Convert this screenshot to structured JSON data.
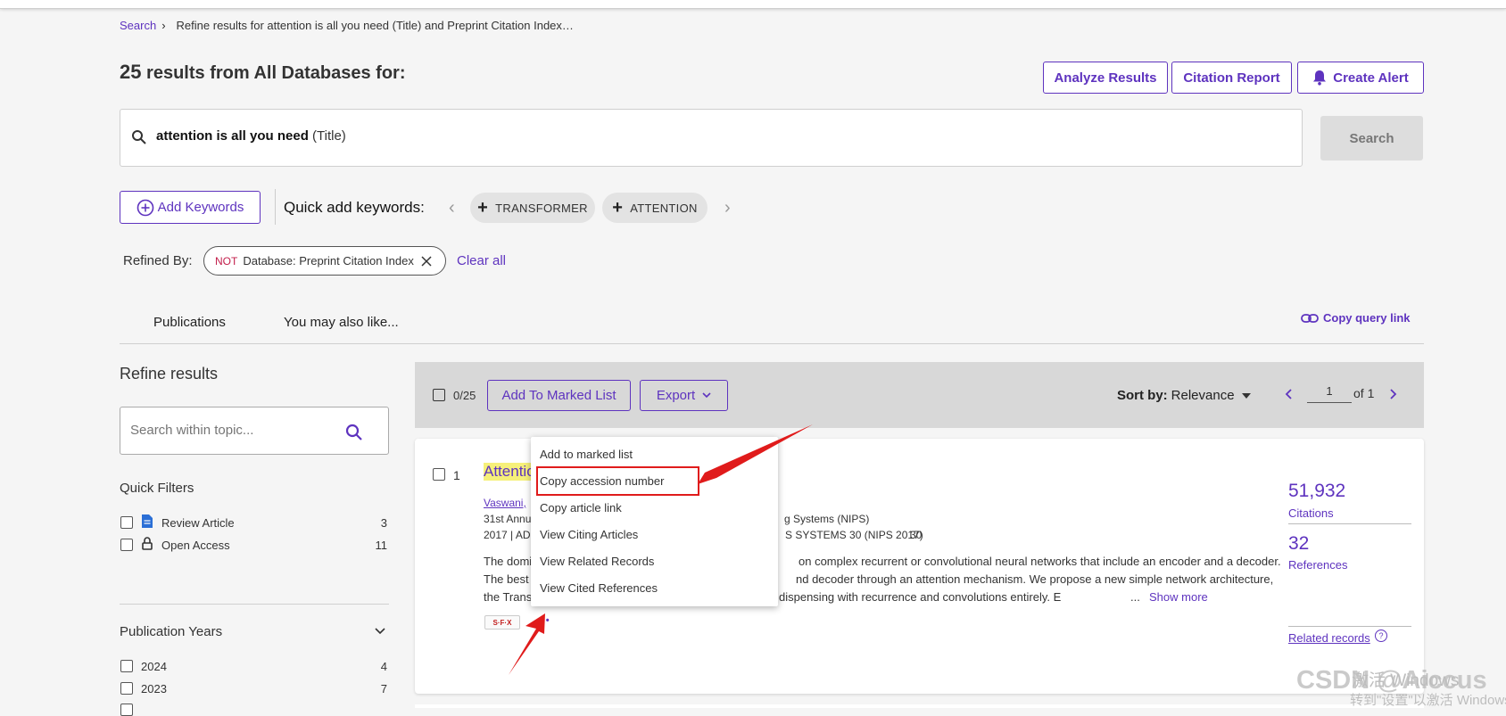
{
  "breadcrumb": {
    "search_link": "Search",
    "separator": "›",
    "current": "Refine results for attention is all you need (Title) and Preprint Citation Index…"
  },
  "results_header": {
    "count": "25",
    "text": "results from All Databases for:"
  },
  "actions": {
    "analyze": "Analyze Results",
    "citation_report": "Citation Report",
    "create_alert": "Create Alert"
  },
  "search": {
    "query_bold": "attention is all you need",
    "query_field": "(Title)",
    "button": "Search"
  },
  "keywords": {
    "add_button": "Add Keywords",
    "quick_label": "Quick add keywords:",
    "chips": [
      "TRANSFORMER",
      "ATTENTION"
    ]
  },
  "refined": {
    "label": "Refined By:",
    "chip_not": "NOT",
    "chip_text": "Database: Preprint Citation Index",
    "clear_all": "Clear all"
  },
  "tabs": {
    "publications": "Publications",
    "also_like": "You may also like...",
    "copy_query": "Copy query link"
  },
  "sidebar": {
    "title": "Refine results",
    "search_placeholder": "Search within topic...",
    "quick_filters_title": "Quick Filters",
    "quick_filters": [
      {
        "label": "Review Article",
        "count": "3"
      },
      {
        "label": "Open Access",
        "count": "11"
      }
    ],
    "years_title": "Publication Years",
    "years": [
      {
        "label": "2024",
        "count": "4"
      },
      {
        "label": "2023",
        "count": "7"
      }
    ]
  },
  "toolbar": {
    "selected": "0/25",
    "add_marked": "Add To Marked List",
    "export": "Export",
    "sort_label": "Sort by:",
    "sort_value": "Relevance",
    "page": "1",
    "of_text": "of 1"
  },
  "record": {
    "index": "1",
    "title_visible": "Attentio",
    "authors_visible": "Vaswani, ",
    "line1_a": "31st Annu",
    "line1_b": "g Systems (NIPS)",
    "line2_a": "2017 | AD",
    "line2_b": "S SYSTEMS 30 (NIPS 2017)",
    "line2_c": "30",
    "abstract1_a": "The domi",
    "abstract1_b": "on complex recurrent or convolutional neural networks that include an encoder and a decoder.",
    "abstract2_a": "The best ",
    "abstract2_b": "nd decoder through an attention mechanism. We propose a new simple network architecture,",
    "abstract3_a": "the Trans",
    "abstract3_b": "dispensing with recurrence and convolutions entirely. E",
    "ellipsis": "...",
    "show_more": "Show more",
    "sfx": "S·F·X",
    "more_dots": "•••",
    "citations": "51,932",
    "citations_label": "Citations",
    "references": "32",
    "references_label": "References",
    "related": "Related records"
  },
  "menu": {
    "items": [
      "Add to marked list",
      "Copy accession number",
      "Copy article link",
      "View Citing Articles",
      "View Related Records",
      "View Cited References"
    ]
  },
  "watermark": {
    "csdn": "CSDN @Aiccus",
    "activate1": "激活 Windows",
    "activate2": "转到\"设置\"以激活 Windows"
  },
  "colors": {
    "accent": "#5e33bf",
    "annotation_red": "#e01b1b",
    "keyword_highlight": "#f6f07a"
  }
}
